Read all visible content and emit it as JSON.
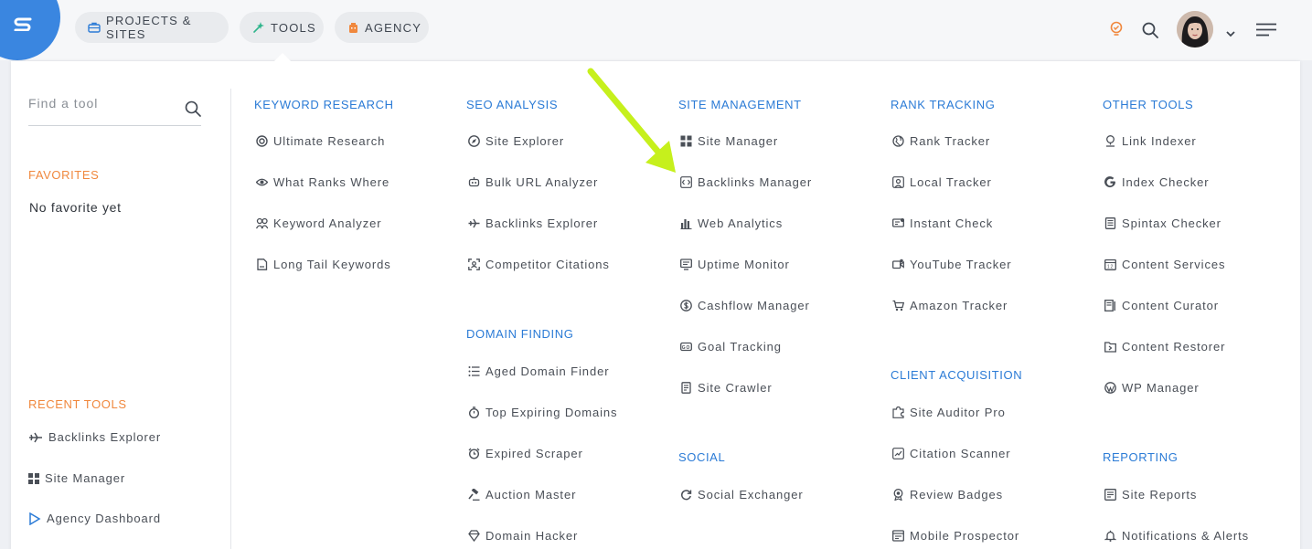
{
  "header": {
    "nav": [
      {
        "label": "PROJECTS & SITES",
        "icon": "briefcase-icon"
      },
      {
        "label": "TOOLS",
        "icon": "wand-icon"
      },
      {
        "label": "AGENCY",
        "icon": "building-icon"
      }
    ],
    "right_icons": [
      "lightbulb-icon",
      "search-icon",
      "avatar",
      "chevron-down-icon",
      "menu-icon"
    ]
  },
  "sidebar": {
    "search_placeholder": "Find a tool",
    "favorites_heading": "FAVORITES",
    "favorites_empty": "No favorite yet",
    "recent_heading": "RECENT TOOLS",
    "recent": [
      {
        "label": "Backlinks Explorer",
        "icon": "plane-icon"
      },
      {
        "label": "Site Manager",
        "icon": "grid-icon"
      },
      {
        "label": "Agency Dashboard",
        "icon": "play-icon"
      }
    ]
  },
  "colors": {
    "accent_blue": "#2b7bd6",
    "accent_orange": "#f0883e",
    "arrow": "#c6f01c",
    "logo": "#3a86e0"
  },
  "columns": [
    {
      "heading": "KEYWORD RESEARCH",
      "tools": [
        {
          "label": "Ultimate Research",
          "icon": "target-icon"
        },
        {
          "label": "What Ranks Where",
          "icon": "eye-icon"
        },
        {
          "label": "Keyword Analyzer",
          "icon": "users-icon"
        },
        {
          "label": "Long Tail Keywords",
          "icon": "file-icon"
        }
      ]
    },
    {
      "heading": "SEO ANALYSIS",
      "tools": [
        {
          "label": "Site Explorer",
          "icon": "compass-icon"
        },
        {
          "label": "Bulk URL Analyzer",
          "icon": "robot-icon"
        },
        {
          "label": "Backlinks Explorer",
          "icon": "plane-icon"
        },
        {
          "label": "Competitor Citations",
          "icon": "scan-icon"
        }
      ],
      "heading2": "DOMAIN FINDING",
      "tools2": [
        {
          "label": "Aged Domain Finder",
          "icon": "list-icon"
        },
        {
          "label": "Top Expiring Domains",
          "icon": "timer-icon"
        },
        {
          "label": "Expired Scraper",
          "icon": "alarm-icon"
        },
        {
          "label": "Auction Master",
          "icon": "gavel-icon"
        },
        {
          "label": "Domain Hacker",
          "icon": "diamond-icon"
        }
      ]
    },
    {
      "heading": "SITE MANAGEMENT",
      "tools": [
        {
          "label": "Site Manager",
          "icon": "grid-icon"
        },
        {
          "label": "Backlinks Manager",
          "icon": "code-icon"
        },
        {
          "label": "Web Analytics",
          "icon": "bar-chart-icon"
        },
        {
          "label": "Uptime Monitor",
          "icon": "monitor-icon"
        },
        {
          "label": "Cashflow Manager",
          "icon": "dollar-icon"
        },
        {
          "label": "Goal Tracking",
          "icon": "goal-icon"
        },
        {
          "label": "Site Crawler",
          "icon": "spider-icon"
        }
      ],
      "heading2": "SOCIAL",
      "tools2": [
        {
          "label": "Social Exchanger",
          "icon": "refresh-icon"
        }
      ]
    },
    {
      "heading": "RANK TRACKING",
      "tools": [
        {
          "label": "Rank Tracker",
          "icon": "globe-icon"
        },
        {
          "label": "Local Tracker",
          "icon": "map-pin-icon"
        },
        {
          "label": "Instant Check",
          "icon": "check-screen-icon"
        },
        {
          "label": "YouTube Tracker",
          "icon": "video-icon"
        },
        {
          "label": "Amazon Tracker",
          "icon": "cart-icon"
        }
      ],
      "heading2": "CLIENT ACQUISITION",
      "tools2": [
        {
          "label": "Site Auditor Pro",
          "icon": "puzzle-icon"
        },
        {
          "label": "Citation Scanner",
          "icon": "scanner-icon"
        },
        {
          "label": "Review Badges",
          "icon": "badge-icon"
        },
        {
          "label": "Mobile Prospector",
          "icon": "browser-icon"
        }
      ]
    },
    {
      "heading": "OTHER TOOLS",
      "tools": [
        {
          "label": "Link Indexer",
          "icon": "index-icon"
        },
        {
          "label": "Index Checker",
          "icon": "google-icon"
        },
        {
          "label": "Spintax Checker",
          "icon": "doc-icon"
        },
        {
          "label": "Content Services",
          "icon": "calendar-icon"
        },
        {
          "label": "Content Curator",
          "icon": "curator-icon"
        },
        {
          "label": "Content Restorer",
          "icon": "folder-icon"
        },
        {
          "label": "WP Manager",
          "icon": "wordpress-icon"
        }
      ],
      "heading2": "REPORTING",
      "tools2": [
        {
          "label": "Site Reports",
          "icon": "report-icon"
        },
        {
          "label": "Notifications & Alerts",
          "icon": "bell-icon"
        }
      ]
    }
  ]
}
